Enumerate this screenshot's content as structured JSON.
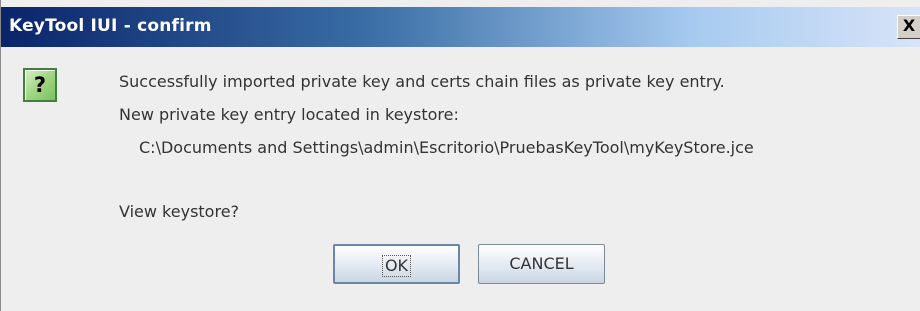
{
  "window": {
    "title": "KeyTool IUI - confirm",
    "close_glyph": "X"
  },
  "icon": {
    "name": "question-icon",
    "glyph": "?"
  },
  "message": {
    "line1": "Successfully imported private key and certs chain files as private key entry.",
    "line2": "New private key entry located in keystore:",
    "path": "C:\\Documents and Settings\\admin\\Escritorio\\PruebasKeyTool\\myKeyStore.jce",
    "question": "View keystore?"
  },
  "buttons": {
    "ok_label": "OK",
    "cancel_label": "CANCEL"
  },
  "colors": {
    "title_bar_start": "#0a246a",
    "title_bar_end": "#d8e4f8",
    "dialog_background": "#eeeeee",
    "icon_green": "#7cc060"
  }
}
